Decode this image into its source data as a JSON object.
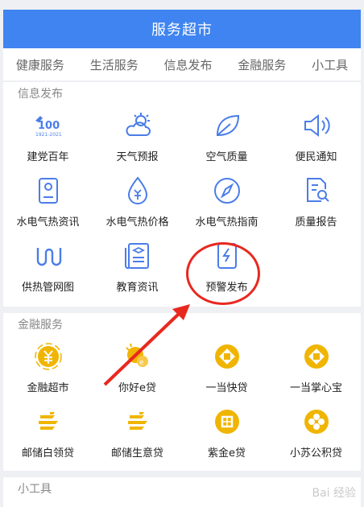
{
  "header": {
    "title": "服务超市"
  },
  "tabs": [
    "健康服务",
    "生活服务",
    "信息发布",
    "金融服务",
    "小工具"
  ],
  "sections": {
    "info": {
      "title": "信息发布",
      "items": [
        {
          "label": "建党百年",
          "icon": "cpc-100-logo-icon",
          "logo_text": "1921-2021"
        },
        {
          "label": "天气预报",
          "icon": "weather-icon"
        },
        {
          "label": "空气质量",
          "icon": "leaf-icon"
        },
        {
          "label": "便民通知",
          "icon": "speaker-icon"
        },
        {
          "label": "水电气热资讯",
          "icon": "document-person-icon"
        },
        {
          "label": "水电气热价格",
          "icon": "price-drop-icon"
        },
        {
          "label": "水电气热指南",
          "icon": "compass-icon"
        },
        {
          "label": "质量报告",
          "icon": "report-search-icon"
        },
        {
          "label": "供热管网图",
          "icon": "pipe-network-icon"
        },
        {
          "label": "教育资讯",
          "icon": "education-news-icon"
        },
        {
          "label": "预警发布",
          "icon": "warning-doc-icon"
        }
      ]
    },
    "finance": {
      "title": "金融服务",
      "items": [
        {
          "label": "金融超市",
          "icon": "yuan-coin-icon"
        },
        {
          "label": "你好e贷",
          "icon": "hello-e-loan-icon"
        },
        {
          "label": "一当快贷",
          "icon": "yidang-coin-icon"
        },
        {
          "label": "一当掌心宝",
          "icon": "yidang-coin-icon"
        },
        {
          "label": "邮储白领贷",
          "icon": "postal-bank-icon"
        },
        {
          "label": "邮储生意贷",
          "icon": "postal-bank-icon"
        },
        {
          "label": "紫金e贷",
          "icon": "zijin-icon"
        },
        {
          "label": "小苏公积贷",
          "icon": "suzhou-coin-icon"
        }
      ]
    },
    "tools": {
      "title": "小工具"
    }
  },
  "watermark": "Bai 经验",
  "colors": {
    "header": "#3f84f1",
    "icon_blue": "#4a7de8",
    "gold": "#f0b500",
    "annotation": "#e8281f"
  }
}
